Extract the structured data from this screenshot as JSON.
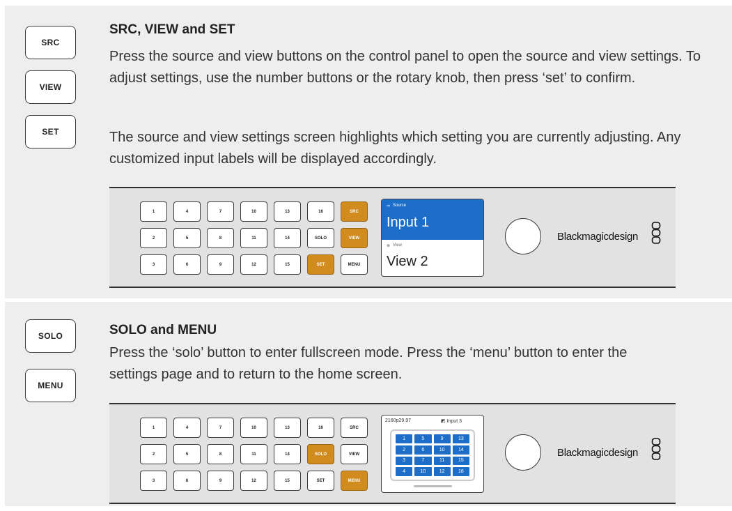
{
  "sections": [
    {
      "side_buttons": [
        "SRC",
        "VIEW",
        "SET"
      ],
      "heading": "SRC, VIEW and SET",
      "paragraphs": [
        "Press the source and view buttons on the control panel to open the source and view settings. To adjust settings, use the number buttons or the rotary knob, then press ‘set’ to confirm.",
        "The source and view settings screen highlights which setting you are currently adjusting. Any customized input labels will be displayed accordingly."
      ],
      "panel": {
        "buttons": [
          [
            "1",
            "4",
            "7",
            "10",
            "13",
            "16",
            "SRC"
          ],
          [
            "2",
            "5",
            "8",
            "11",
            "14",
            "SOLO",
            "VIEW"
          ],
          [
            "3",
            "6",
            "9",
            "12",
            "15",
            "SET",
            "MENU"
          ]
        ],
        "highlighted": [
          "SRC",
          "VIEW",
          "SET"
        ],
        "lcd": {
          "source_label": "Source",
          "source_value": "Input 1",
          "view_label": "View",
          "view_value": "View 2"
        },
        "brand": "Blackmagicdesign"
      }
    },
    {
      "side_buttons": [
        "SOLO",
        "MENU"
      ],
      "heading": "SOLO and MENU",
      "paragraphs": [
        "Press the ‘solo’ button to enter fullscreen mode. Press the ‘menu’ button to enter the settings page and to return to the home screen."
      ],
      "panel": {
        "buttons": [
          [
            "1",
            "4",
            "7",
            "10",
            "13",
            "16",
            "SRC"
          ],
          [
            "2",
            "5",
            "8",
            "11",
            "14",
            "SOLO",
            "VIEW"
          ],
          [
            "3",
            "6",
            "9",
            "12",
            "15",
            "SET",
            "MENU"
          ]
        ],
        "highlighted": [
          "SOLO",
          "MENU"
        ],
        "lcd": {
          "format": "2160p29.97",
          "audio_input": "Input 3",
          "grid": [
            "1",
            "5",
            "9",
            "13",
            "2",
            "6",
            "10",
            "14",
            "3",
            "7",
            "11",
            "15",
            "4",
            "10",
            "12",
            "16"
          ]
        },
        "brand": "Blackmagicdesign"
      }
    }
  ],
  "colors": {
    "section_bg": "#eeeeee",
    "highlight_button": "#d18b1f",
    "lcd_blue": "#1d6ec8"
  }
}
